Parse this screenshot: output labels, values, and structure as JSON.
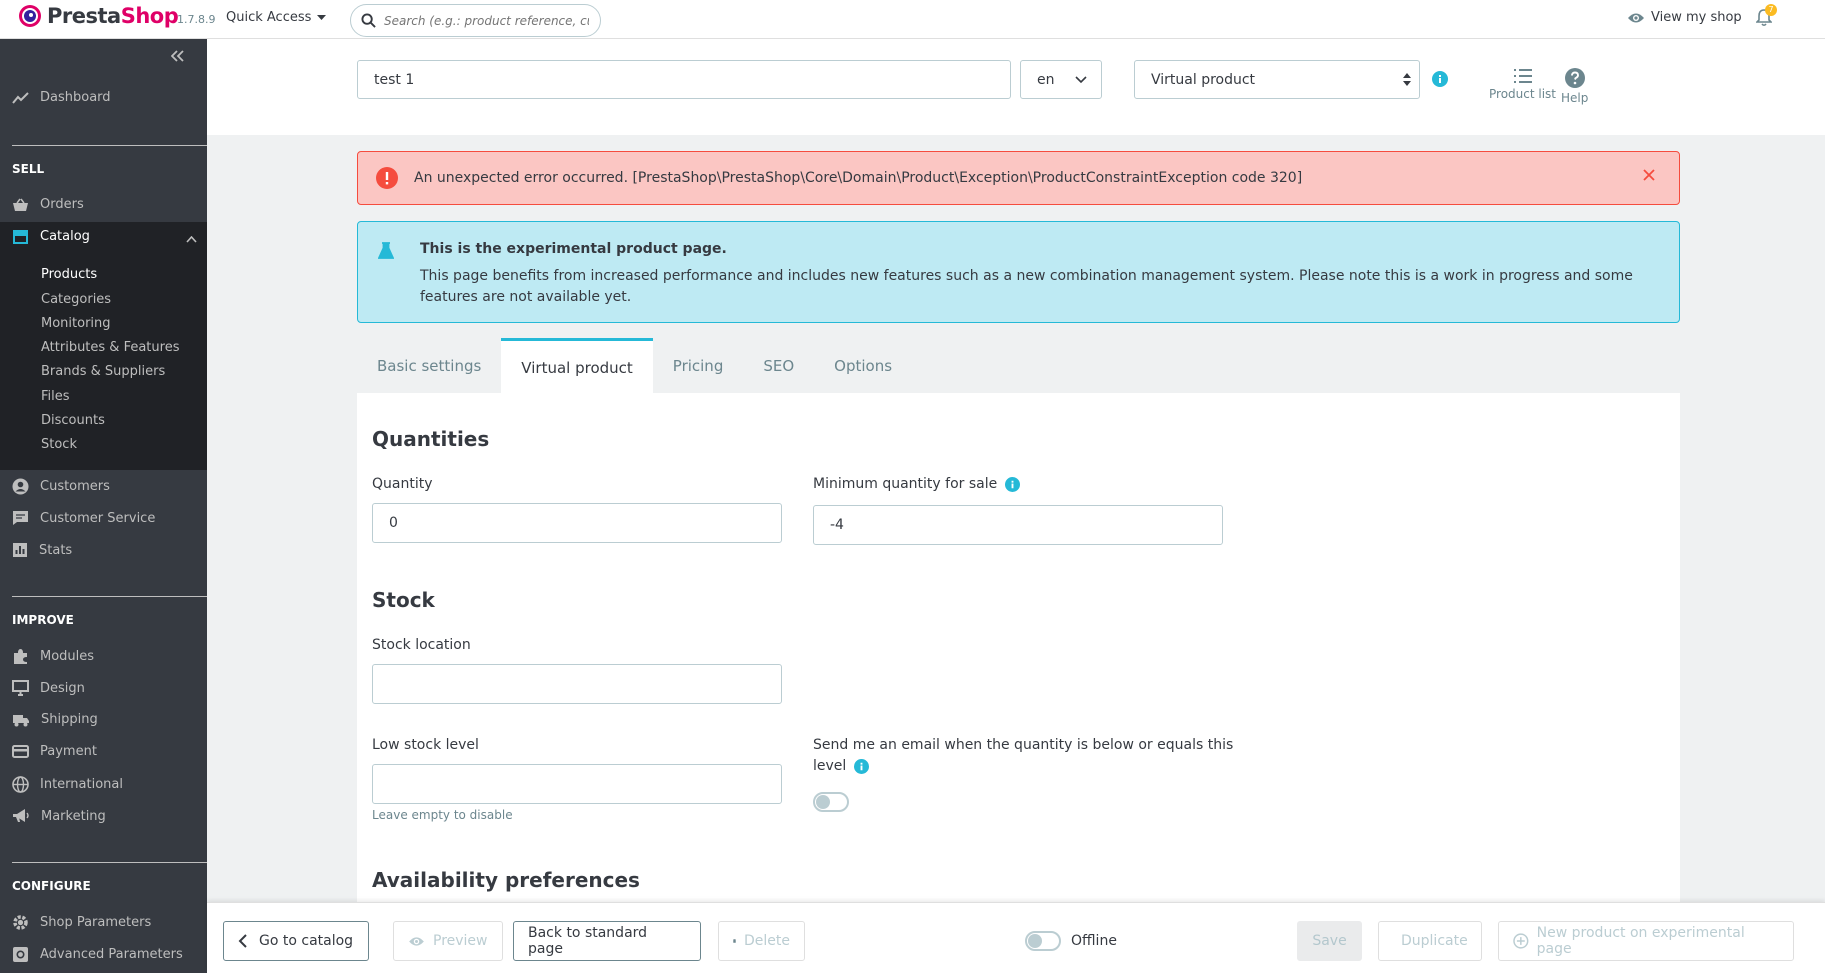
{
  "topbar": {
    "brand": "PrestaShop",
    "version": "1.7.8.9",
    "quick_access": "Quick Access",
    "search_placeholder": "Search (e.g.: product reference, custon",
    "view_shop": "View my shop",
    "notifications_count": "7"
  },
  "sidebar": {
    "dashboard": "Dashboard",
    "sell_heading": "SELL",
    "orders": "Orders",
    "catalog": "Catalog",
    "catalog_sub": [
      "Products",
      "Categories",
      "Monitoring",
      "Attributes & Features",
      "Brands & Suppliers",
      "Files",
      "Discounts",
      "Stock"
    ],
    "customers": "Customers",
    "customer_service": "Customer Service",
    "stats": "Stats",
    "improve_heading": "IMPROVE",
    "modules": "Modules",
    "design": "Design",
    "shipping": "Shipping",
    "payment": "Payment",
    "international": "International",
    "marketing": "Marketing",
    "configure_heading": "CONFIGURE",
    "shop_parameters": "Shop Parameters",
    "advanced_parameters": "Advanced Parameters"
  },
  "header": {
    "product_name": "test 1",
    "language": "en",
    "product_type": "Virtual product",
    "product_list": "Product list",
    "help": "Help"
  },
  "alerts": {
    "error": "An unexpected error occurred. [PrestaShop\\PrestaShop\\Core\\Domain\\Product\\Exception\\ProductConstraintException code 320]",
    "info_title": "This is the experimental product page.",
    "info_body": "This page benefits from increased performance and includes new features such as a new combination management system. Please note this is a work in progress and some features are not available yet."
  },
  "tabs": [
    "Basic settings",
    "Virtual product",
    "Pricing",
    "SEO",
    "Options"
  ],
  "form": {
    "quantities_heading": "Quantities",
    "quantity_label": "Quantity",
    "quantity_value": "0",
    "min_qty_label": "Minimum quantity for sale",
    "min_qty_value": "-4",
    "stock_heading": "Stock",
    "stock_location_label": "Stock location",
    "stock_location_value": "",
    "low_stock_label": "Low stock level",
    "low_stock_value": "",
    "low_stock_hint": "Leave empty to disable",
    "email_alert_label_1": "Send me an email when the quantity is below or equals this",
    "email_alert_label_2": "level",
    "availability_heading": "Availability preferences"
  },
  "footer": {
    "go_to_catalog": "Go to catalog",
    "preview": "Preview",
    "back_to_standard": "Back to standard page",
    "delete": "Delete",
    "offline": "Offline",
    "save": "Save",
    "duplicate": "Duplicate",
    "new_product": "New product on experimental page"
  },
  "colors": {
    "accent": "#25b9d7",
    "brand_pink": "#df0067",
    "sidebar_bg": "#363a41",
    "danger": "#f54c3e"
  }
}
